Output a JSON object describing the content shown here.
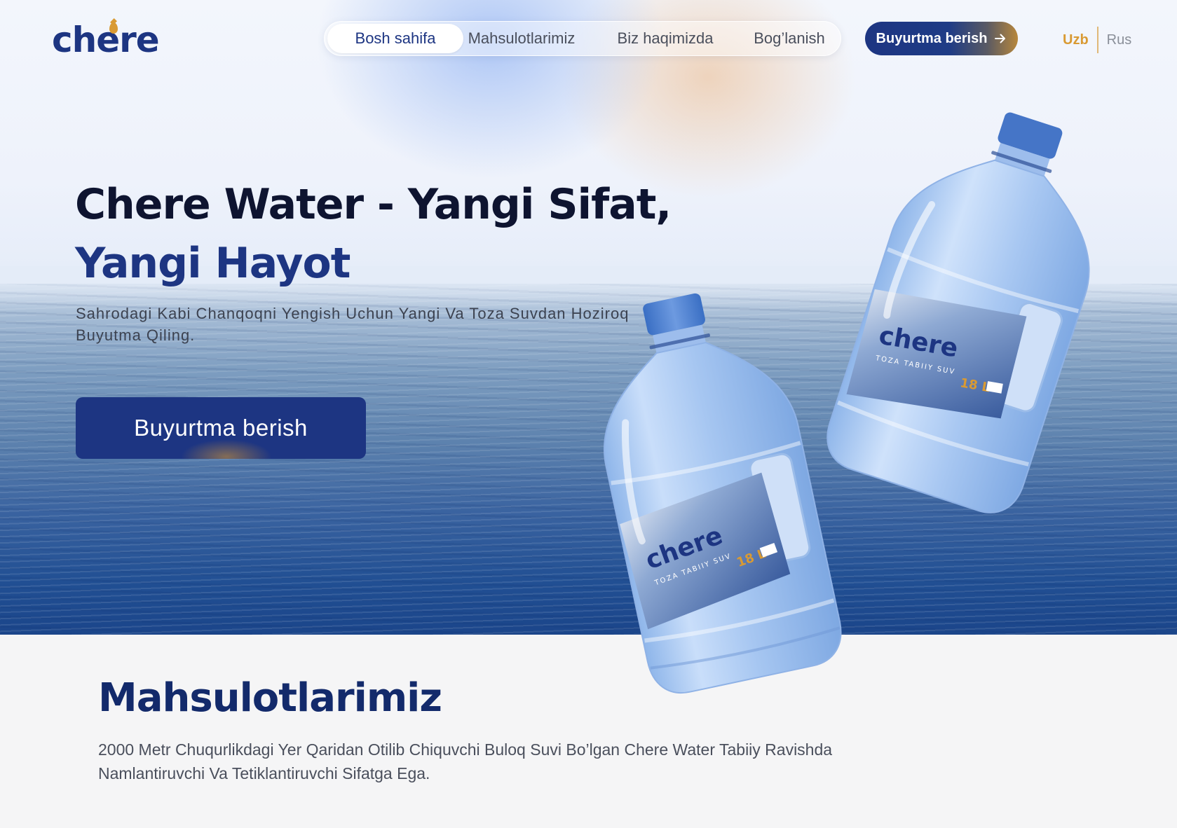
{
  "brand": {
    "logo_text": "chere",
    "accent_color": "#d99a33",
    "primary_color": "#1d3582"
  },
  "nav": {
    "items": [
      {
        "label": "Bosh sahifa",
        "active": true
      },
      {
        "label": "Mahsulotlarimiz",
        "active": false
      },
      {
        "label": "Biz haqimizda",
        "active": false
      },
      {
        "label": "Bog’lanish",
        "active": false
      }
    ],
    "order_button": "Buyurtma berish",
    "order_icon": "arrow-right-icon"
  },
  "language": {
    "current": "Uzb",
    "other": "Rus"
  },
  "hero": {
    "headline_line1": "Chere Water - Yangi Sifat,",
    "headline_line2": "Yangi Hayot",
    "subtitle": "Sahrodagi Kabi Chanqoqni Yengish Uchun Yangi Va Toza Suvdan Hoziroq Buyutma Qiling.",
    "cta_label": "Buyurtma berish"
  },
  "product": {
    "label_brand": "chere",
    "label_tagline": "TOZA TABIIY SUV",
    "label_volume": "18 L"
  },
  "products_section": {
    "title": "Mahsulotlarimiz",
    "description": "2000 Metr Chuqurlikdagi Yer Qaridan Otilib Chiquvchi Buloq Suvi Bo’lgan Chere Water Tabiiy Ravishda Namlantiruvchi Va Tetiklantiruvchi Sifatga Ega."
  }
}
